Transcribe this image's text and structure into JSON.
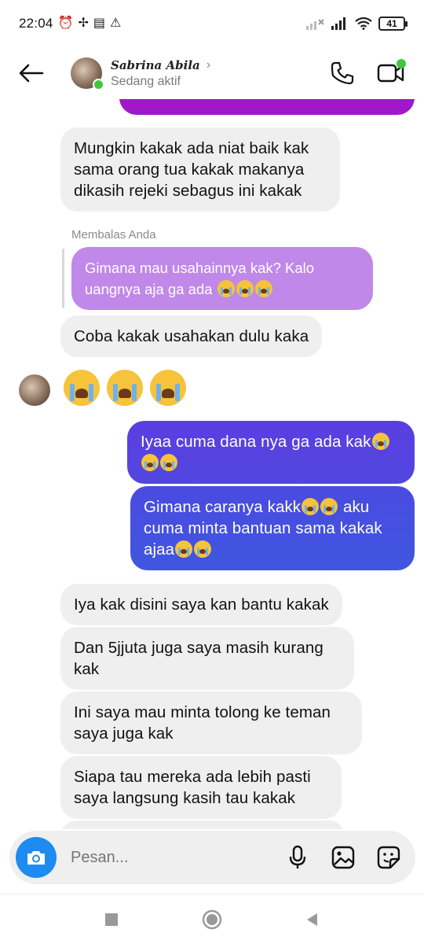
{
  "status_bar": {
    "time": "22:04",
    "battery": "41"
  },
  "header": {
    "contact_name": "Sabrina Abila",
    "contact_status": "Sedang aktif"
  },
  "messages": {
    "m1": "Mungkin kakak ada niat baik kak sama orang tua kakak makanya dikasih rejeki sebagus ini kakak",
    "reply_label": "Membalas Anda",
    "replied_text": "Gimana mau usahainnya kak? Kalo uangnya aja ga ada",
    "m2": "Coba kakak usahakan dulu kaka",
    "out1": "Iyaa cuma dana nya ga ada kak",
    "out2a": "Gimana caranya kakk",
    "out2b": "aku cuma minta bantuan sama kakak ajaa",
    "m3": "Iya kak disini saya kan bantu kakak",
    "m4": "Dan 5jjuta juga saya masih kurang kak",
    "m5": "Ini saya mau minta tolong ke teman saya juga kak",
    "m6": "Siapa tau mereka ada lebih pasti saya langsung kasih tau kakak"
  },
  "composer": {
    "placeholder": "Pesan..."
  },
  "colors": {
    "outgoing_top": "#5b3ee0",
    "outgoing_bottom": "#3f56e0",
    "incoming": "#efefef",
    "replied": "#c088e8",
    "online": "#3fc63f",
    "camera": "#1d8bf0"
  }
}
